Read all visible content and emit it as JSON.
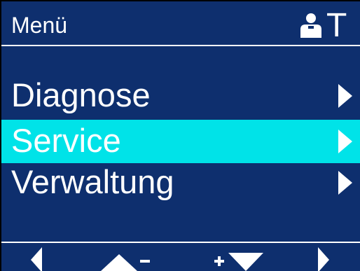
{
  "header": {
    "title": "Menü",
    "user_icon": "person-icon",
    "user_level": "T"
  },
  "menu": {
    "selected_index": 1,
    "items": [
      {
        "label": "Diagnose",
        "arrow_icon": "chevron-right-icon"
      },
      {
        "label": "Service",
        "arrow_icon": "chevron-right-icon"
      },
      {
        "label": "Verwaltung",
        "arrow_icon": "chevron-right-icon"
      }
    ]
  },
  "softkeys": {
    "left_icon": "triangle-left-icon",
    "up_minus_icon": "triangle-up-minus-icon",
    "plus_down_icon": "plus-triangle-down-icon",
    "right_icon": "triangle-right-icon"
  },
  "colors": {
    "background": "#0e2f6e",
    "highlight": "#00e3e8",
    "foreground": "#ffffff"
  }
}
